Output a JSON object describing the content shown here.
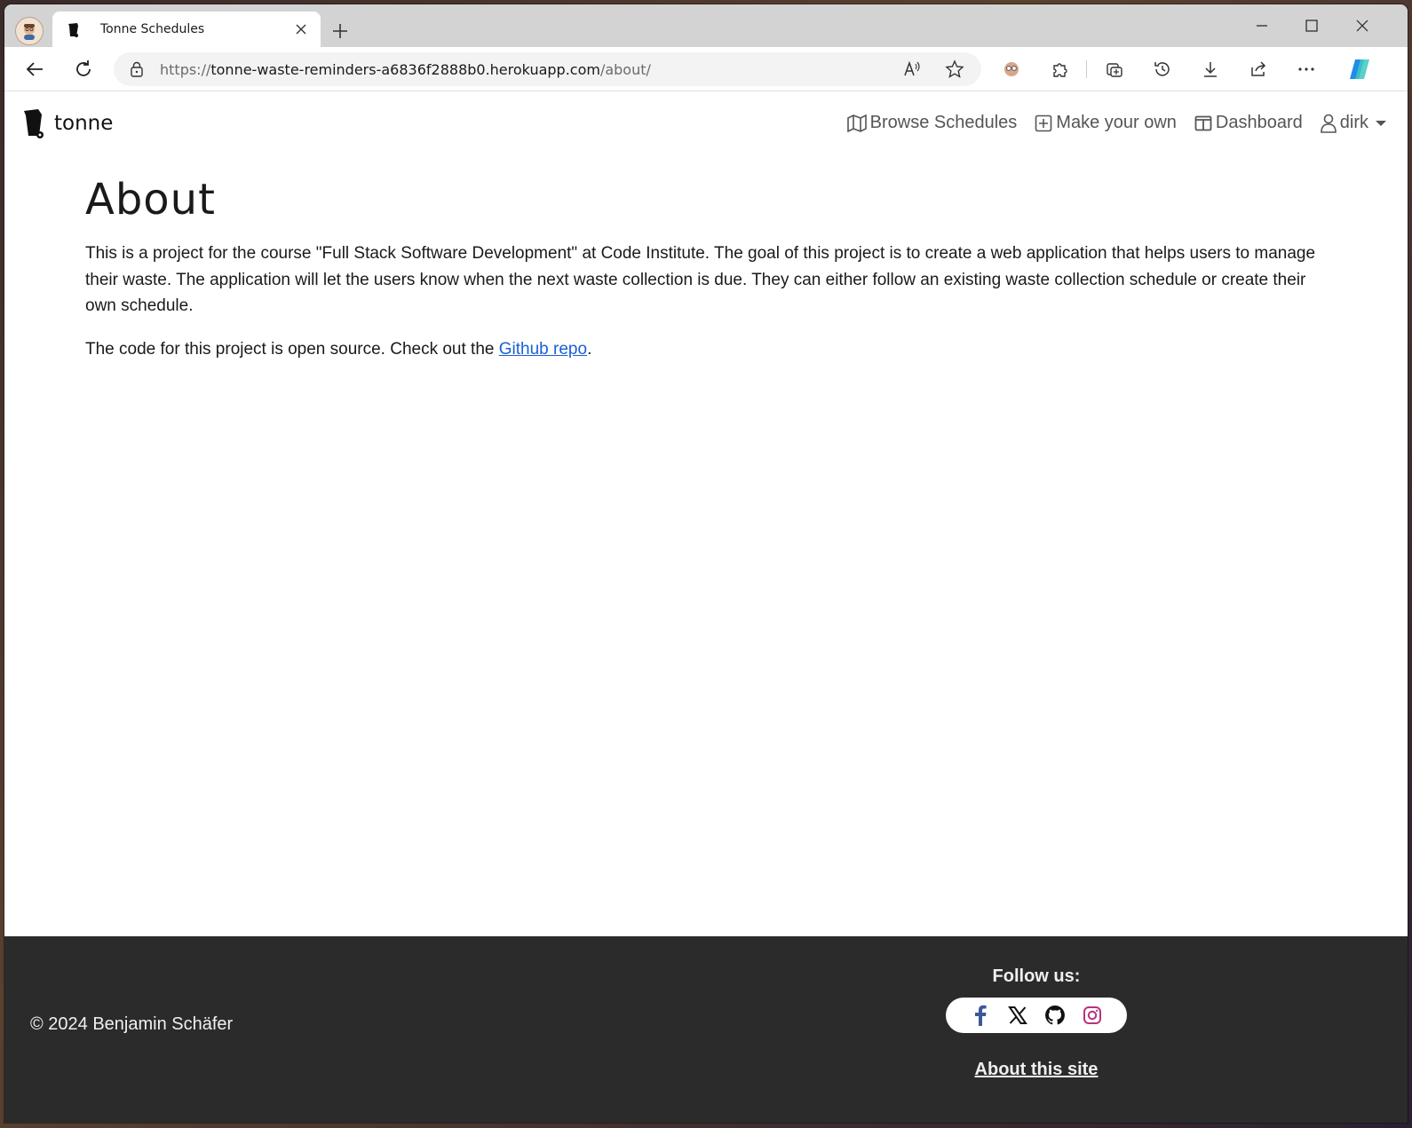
{
  "browser": {
    "tab_title": "Tonne Schedules",
    "url_prefix": "https://",
    "url_host": "tonne-waste-reminders-a6836f2888b0.herokuapp.com",
    "url_path": "/about/"
  },
  "site": {
    "brand": "tonne",
    "nav": {
      "browse": "Browse Schedules",
      "make": "Make your own",
      "dashboard": "Dashboard",
      "user": "dirk"
    }
  },
  "main": {
    "title": "About",
    "paragraph1": "This is a project for the course \"Full Stack Software Development\" at Code Institute. The goal of this project is to create a web application that helps users to manage their waste. The application will let the users know when the next waste collection is due. They can either follow an existing waste collection schedule or create their own schedule.",
    "paragraph2_before": "The code for this project is open source. Check out the ",
    "paragraph2_link": "Github repo",
    "paragraph2_after": "."
  },
  "footer": {
    "copyright": "© 2024 Benjamin Schäfer",
    "follow_title": "Follow us:",
    "about_link": "About this site",
    "social_icons": [
      "facebook-icon",
      "x-icon",
      "github-icon",
      "instagram-icon"
    ]
  },
  "colors": {
    "link": "#1a5fd6",
    "footer_bg": "#2b2b2b",
    "facebook": "#3b5998",
    "instagram": "#b4337f"
  }
}
